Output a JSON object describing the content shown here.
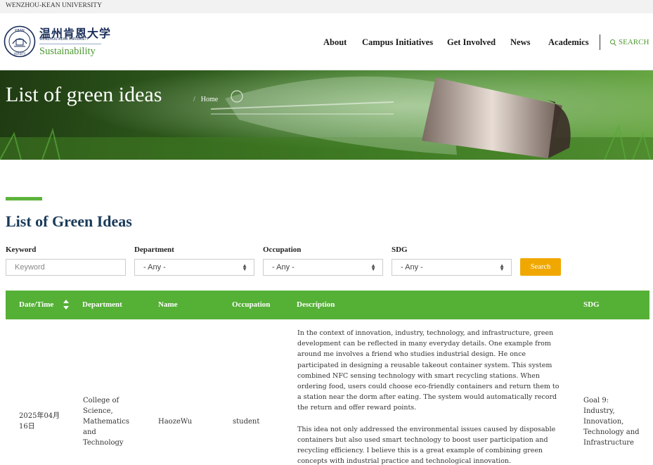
{
  "topbar": {
    "university": "WENZHOU-KEAN UNIVERSITY"
  },
  "brand": {
    "cn_name": "温州肯恩大学",
    "en_name": "WENZHOU-KEAN UNIVERSITY",
    "subtitle": "Sustainability"
  },
  "nav": {
    "items": [
      "About",
      "Campus Initiatives",
      "Get Involved",
      "News",
      "Academics"
    ],
    "search_label": "SEARCH"
  },
  "hero": {
    "title": "List of green ideas",
    "breadcrumb": "Home"
  },
  "section": {
    "title": "List of Green Ideas"
  },
  "filters": {
    "keyword_label": "Keyword",
    "keyword_placeholder": "Keyword",
    "department_label": "Department",
    "department_value": "- Any -",
    "occupation_label": "Occupation",
    "occupation_value": "- Any -",
    "sdg_label": "SDG",
    "sdg_value": "- Any -",
    "search_button": "Search"
  },
  "table": {
    "headers": [
      "Date/Time",
      "Department",
      "Name",
      "Occupation",
      "Description",
      "SDG"
    ],
    "rows": [
      {
        "date": "2025年04月16日",
        "department": "College of Science, Mathematics and Technology",
        "name": "HaozeWu",
        "occupation": "student",
        "description_p1": "In the context of innovation, industry, technology, and infrastructure, green development can be reflected in many everyday details. One example from around me involves a friend who studies industrial design. He once participated in designing a reusable takeout container system. This system combined NFC sensing technology with smart recycling stations. When ordering food, users could choose eco-friendly containers and return them to a station near the dorm after eating. The system would automatically record the return and offer reward points.",
        "description_p2": "This idea not only addressed the environmental issues caused by disposable containers but also used smart technology to boost user participation and recycling efficiency. I believe this is a great example of combining green concepts with industrial practice and technological innovation.",
        "sdg": "Goal 9: Industry, Innovation, Technology and Infrastructure"
      }
    ]
  },
  "colors": {
    "brand_green": "#55b036",
    "search_orange": "#f0a800",
    "title_navy": "#1a3a5a"
  }
}
